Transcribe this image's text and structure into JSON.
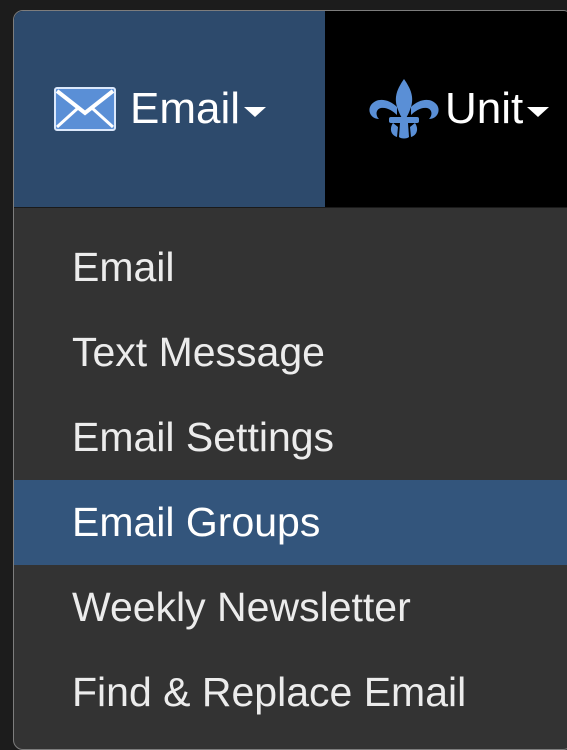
{
  "navbar": {
    "email": {
      "label": "Email",
      "icon": "envelope-icon"
    },
    "unit": {
      "label": "Unit",
      "icon": "fleur-de-lis-icon"
    }
  },
  "menu": {
    "items": [
      {
        "label": "Email"
      },
      {
        "label": "Text Message"
      },
      {
        "label": "Email Settings"
      },
      {
        "label": "Email Groups",
        "active": true
      },
      {
        "label": "Weekly Newsletter"
      },
      {
        "label": "Find & Replace Email"
      }
    ]
  },
  "colors": {
    "navbar_bg": "#000000",
    "email_tab_bg": "#2d4a6c",
    "menu_bg": "#333333",
    "highlight_bg": "#33557c",
    "text": "#ffffff"
  }
}
